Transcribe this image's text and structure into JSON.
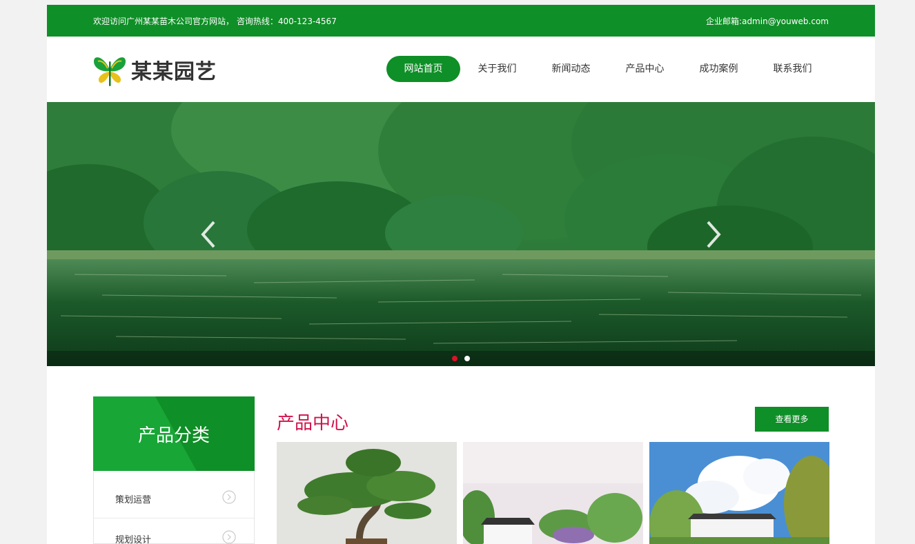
{
  "topbar": {
    "welcome": "欢迎访问广州某某苗木公司官方网站， 咨询热线：400-123-4567",
    "email": "企业邮箱:admin@youweb.com"
  },
  "brand": {
    "name": "某某园艺"
  },
  "nav": [
    {
      "label": "网站首页",
      "active": true
    },
    {
      "label": "关于我们"
    },
    {
      "label": "新闻动态"
    },
    {
      "label": "产品中心"
    },
    {
      "label": "成功案例"
    },
    {
      "label": "联系我们"
    }
  ],
  "banner": {
    "prev_icon": "chevron-left-icon",
    "next_icon": "chevron-right-icon",
    "slides": 2,
    "active_slide": 1
  },
  "categories": {
    "title": "产品分类",
    "items": [
      {
        "label": "策划运营",
        "icon": "chevron-right-circle-icon"
      },
      {
        "label": "规划设计",
        "icon": "chevron-right-circle-icon"
      }
    ]
  },
  "products": {
    "title": "产品中心",
    "more_label": "查看更多"
  },
  "colors": {
    "brand_green": "#0f8f27",
    "title_red": "#d0124b",
    "page_bg": "#f2f2f2"
  }
}
